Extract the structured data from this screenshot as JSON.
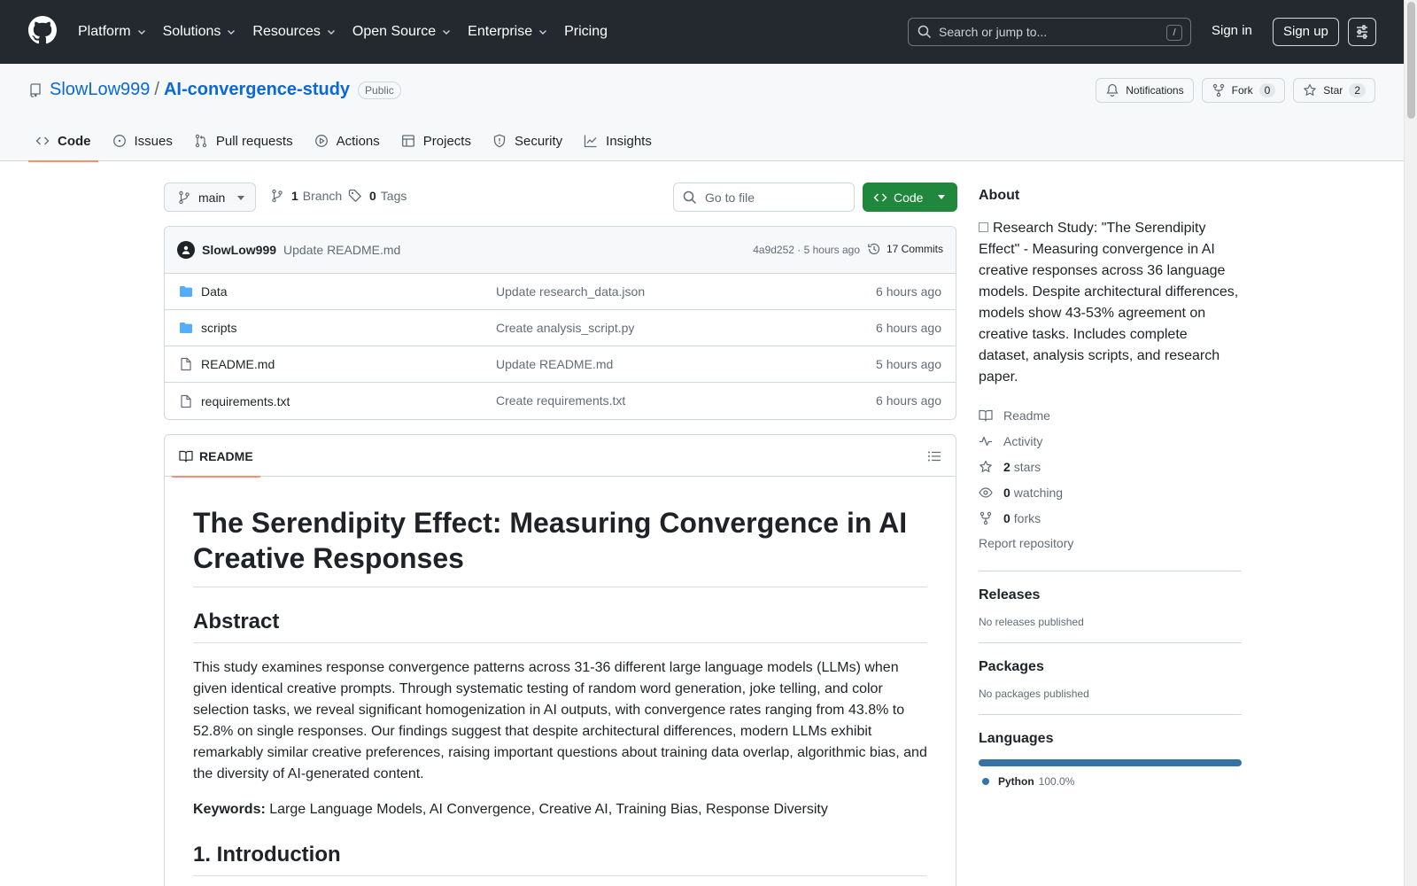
{
  "header": {
    "nav": [
      "Platform",
      "Solutions",
      "Resources",
      "Open Source",
      "Enterprise",
      "Pricing"
    ],
    "search_placeholder": "Search or jump to...",
    "search_key": "/",
    "sign_in": "Sign in",
    "sign_up": "Sign up"
  },
  "repo": {
    "owner": "SlowLow999",
    "sep": "/",
    "name": "AI-convergence-study",
    "visibility": "Public",
    "notifications": "Notifications",
    "fork_label": "Fork",
    "fork_count": "0",
    "star_label": "Star",
    "star_count": "2",
    "tabs": [
      "Code",
      "Issues",
      "Pull requests",
      "Actions",
      "Projects",
      "Security",
      "Insights"
    ]
  },
  "toolbar": {
    "branch": "main",
    "branch_count": "1",
    "branch_label": "Branch",
    "tag_count": "0",
    "tag_label": "Tags",
    "goto_placeholder": "Go to file",
    "code_button": "Code"
  },
  "commit": {
    "author": "SlowLow999",
    "message": "Update README.md",
    "meta": "4a9d252 · 5 hours ago",
    "commits": "17 Commits"
  },
  "files": [
    {
      "name": "Data",
      "type": "folder",
      "message": "Update research_data.json",
      "time": "6 hours ago"
    },
    {
      "name": "scripts",
      "type": "folder",
      "message": "Create analysis_script.py",
      "time": "6 hours ago"
    },
    {
      "name": "README.md",
      "type": "file",
      "message": "Update README.md",
      "time": "5 hours ago"
    },
    {
      "name": "requirements.txt",
      "type": "file",
      "message": "Create requirements.txt",
      "time": "6 hours ago"
    }
  ],
  "readme": {
    "tab": "README",
    "title": "The Serendipity Effect: Measuring Convergence in AI Creative Responses",
    "abstract_heading": "Abstract",
    "abstract": "This study examines response convergence patterns across 31-36 different large language models (LLMs) when given identical creative prompts. Through systematic testing of random word generation, joke telling, and color selection tasks, we reveal significant homogenization in AI outputs, with convergence rates ranging from 43.8% to 52.8% on single responses. Our findings suggest that despite architectural differences, modern LLMs exhibit remarkably similar creative preferences, raising important questions about training data overlap, algorithmic bias, and the diversity of AI-generated content.",
    "keywords_label": "Keywords:",
    "keywords": " Large Language Models, AI Convergence, Creative AI, Training Bias, Response Diversity",
    "intro_heading": "1. Introduction"
  },
  "about": {
    "title": "About",
    "description": "Research Study: \"The Serendipity Effect\" - Measuring convergence in AI creative responses across 36 language models. Despite architectural differences, models show 43-53% agreement on creative tasks. Includes complete dataset, analysis scripts, and research paper.",
    "readme": "Readme",
    "activity": "Activity",
    "stars_count": "2",
    "stars_label": "stars",
    "watching_count": "0",
    "watching_label": "watching",
    "forks_count": "0",
    "forks_label": "forks",
    "report": "Report repository"
  },
  "releases": {
    "title": "Releases",
    "empty": "No releases published"
  },
  "packages": {
    "title": "Packages",
    "empty": "No packages published"
  },
  "languages": {
    "title": "Languages",
    "items": [
      {
        "name": "Python",
        "percent": "100.0%",
        "fraction": 1.0,
        "color": "#3572a5"
      }
    ]
  },
  "colors": {
    "header_bg": "#24292f",
    "link": "#0969da",
    "primary_button": "#1f883d",
    "active_tab": "#fd8c73"
  }
}
